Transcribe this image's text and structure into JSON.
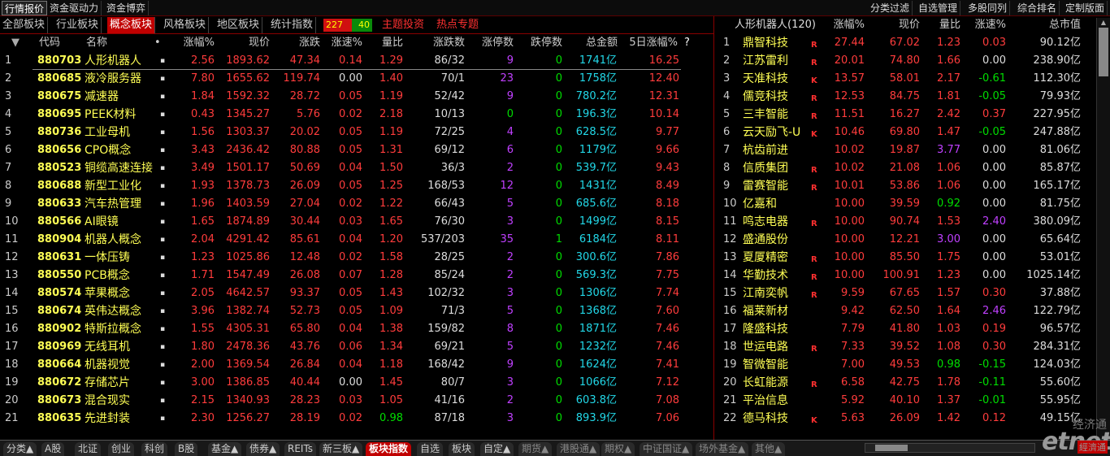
{
  "top_tabs": [
    "行情报价",
    "资金驱动力",
    "资金博弈"
  ],
  "top_right_tabs": [
    "分类过滤",
    "自选管理",
    "多股同列",
    "综合排名",
    "定制版面"
  ],
  "sector_tabs": [
    "全部板块",
    "行业板块",
    "概念板块",
    "风格板块",
    "地区板块",
    "统计指数"
  ],
  "active_sector_tab": "概念板块",
  "ratio": {
    "up": "227",
    "down": "40"
  },
  "links": [
    "主题投资",
    "热点专题"
  ],
  "columns": {
    "sort": "▼",
    "code": "代码",
    "name": "名称",
    "dot": "•",
    "pct": "涨幅%",
    "price": "现价",
    "change": "涨跌",
    "speed": "涨速%",
    "vol_ratio": "量比",
    "updown": "涨跌数",
    "limit_up": "涨停数",
    "limit_down": "跌停数",
    "amount": "总金额",
    "pct5": "5日涨幅%",
    "help": "?"
  },
  "rows": [
    {
      "i": "1",
      "code": "880703",
      "name": "人形机器人",
      "pct": "2.56",
      "price": "1893.62",
      "chg": "47.34",
      "speed": "0.14",
      "vr": "1.29",
      "ud": "86/32",
      "lu": "9",
      "ld": "0",
      "amt": "1741",
      "unit": "亿",
      "p5": "16.25"
    },
    {
      "i": "2",
      "code": "880685",
      "name": "液冷服务器",
      "pct": "7.80",
      "price": "1655.62",
      "chg": "119.74",
      "speed": "0.00",
      "vr": "1.40",
      "ud": "70/1",
      "lu": "23",
      "ld": "0",
      "amt": "1758",
      "unit": "亿",
      "p5": "12.40"
    },
    {
      "i": "3",
      "code": "880675",
      "name": "减速器",
      "pct": "1.84",
      "price": "1592.32",
      "chg": "28.72",
      "speed": "0.05",
      "vr": "1.19",
      "ud": "52/42",
      "lu": "9",
      "ld": "0",
      "amt": "780.2",
      "unit": "亿",
      "p5": "12.31"
    },
    {
      "i": "4",
      "code": "880695",
      "name": "PEEK材料",
      "pct": "0.43",
      "price": "1345.27",
      "chg": "5.76",
      "speed": "0.02",
      "vr": "2.18",
      "ud": "10/13",
      "lu": "0",
      "ld": "0",
      "amt": "196.3",
      "unit": "亿",
      "p5": "10.14"
    },
    {
      "i": "5",
      "code": "880736",
      "name": "工业母机",
      "pct": "1.56",
      "price": "1303.37",
      "chg": "20.02",
      "speed": "0.05",
      "vr": "1.19",
      "ud": "72/25",
      "lu": "4",
      "ld": "0",
      "amt": "628.5",
      "unit": "亿",
      "p5": "9.77"
    },
    {
      "i": "6",
      "code": "880656",
      "name": "CPO概念",
      "pct": "3.43",
      "price": "2436.42",
      "chg": "80.88",
      "speed": "0.05",
      "vr": "1.31",
      "ud": "69/12",
      "lu": "6",
      "ld": "0",
      "amt": "1179",
      "unit": "亿",
      "p5": "9.66"
    },
    {
      "i": "7",
      "code": "880523",
      "name": "铜缆高速连接",
      "pct": "3.49",
      "price": "1501.17",
      "chg": "50.69",
      "speed": "0.04",
      "vr": "1.50",
      "ud": "36/3",
      "lu": "2",
      "ld": "0",
      "amt": "539.7",
      "unit": "亿",
      "p5": "9.43"
    },
    {
      "i": "8",
      "code": "880688",
      "name": "新型工业化",
      "pct": "1.93",
      "price": "1378.73",
      "chg": "26.09",
      "speed": "0.05",
      "vr": "1.25",
      "ud": "168/53",
      "lu": "12",
      "ld": "0",
      "amt": "1431",
      "unit": "亿",
      "p5": "8.49"
    },
    {
      "i": "9",
      "code": "880633",
      "name": "汽车热管理",
      "pct": "1.96",
      "price": "1403.59",
      "chg": "27.04",
      "speed": "0.02",
      "vr": "1.22",
      "ud": "66/43",
      "lu": "5",
      "ld": "0",
      "amt": "685.6",
      "unit": "亿",
      "p5": "8.18"
    },
    {
      "i": "10",
      "code": "880566",
      "name": "AI眼镜",
      "pct": "1.65",
      "price": "1874.89",
      "chg": "30.44",
      "speed": "0.03",
      "vr": "1.65",
      "ud": "76/30",
      "lu": "3",
      "ld": "0",
      "amt": "1499",
      "unit": "亿",
      "p5": "8.15"
    },
    {
      "i": "11",
      "code": "880904",
      "name": "机器人概念",
      "pct": "2.04",
      "price": "4291.42",
      "chg": "85.61",
      "speed": "0.04",
      "vr": "1.20",
      "ud": "537/203",
      "lu": "35",
      "ld": "1",
      "amt": "6184",
      "unit": "亿",
      "p5": "8.11"
    },
    {
      "i": "12",
      "code": "880631",
      "name": "一体压铸",
      "pct": "1.23",
      "price": "1025.86",
      "chg": "12.48",
      "speed": "0.02",
      "vr": "1.58",
      "ud": "28/25",
      "lu": "2",
      "ld": "0",
      "amt": "300.6",
      "unit": "亿",
      "p5": "7.86"
    },
    {
      "i": "13",
      "code": "880550",
      "name": "PCB概念",
      "pct": "1.71",
      "price": "1547.49",
      "chg": "26.08",
      "speed": "0.07",
      "vr": "1.28",
      "ud": "85/24",
      "lu": "2",
      "ld": "0",
      "amt": "569.3",
      "unit": "亿",
      "p5": "7.75"
    },
    {
      "i": "14",
      "code": "880574",
      "name": "苹果概念",
      "pct": "2.05",
      "price": "4642.57",
      "chg": "93.37",
      "speed": "0.05",
      "vr": "1.43",
      "ud": "102/32",
      "lu": "3",
      "ld": "0",
      "amt": "1306",
      "unit": "亿",
      "p5": "7.74"
    },
    {
      "i": "15",
      "code": "880674",
      "name": "英伟达概念",
      "pct": "3.96",
      "price": "1382.74",
      "chg": "52.73",
      "speed": "0.05",
      "vr": "1.09",
      "ud": "71/3",
      "lu": "5",
      "ld": "0",
      "amt": "1368",
      "unit": "亿",
      "p5": "7.60"
    },
    {
      "i": "16",
      "code": "880902",
      "name": "特斯拉概念",
      "pct": "1.55",
      "price": "4305.31",
      "chg": "65.80",
      "speed": "0.04",
      "vr": "1.38",
      "ud": "159/82",
      "lu": "8",
      "ld": "0",
      "amt": "1871",
      "unit": "亿",
      "p5": "7.46"
    },
    {
      "i": "17",
      "code": "880969",
      "name": "无线耳机",
      "pct": "1.80",
      "price": "2478.36",
      "chg": "43.76",
      "speed": "0.06",
      "vr": "1.34",
      "ud": "69/21",
      "lu": "5",
      "ld": "0",
      "amt": "1232",
      "unit": "亿",
      "p5": "7.46"
    },
    {
      "i": "18",
      "code": "880664",
      "name": "机器视觉",
      "pct": "2.00",
      "price": "1369.54",
      "chg": "26.84",
      "speed": "0.04",
      "vr": "1.18",
      "ud": "168/42",
      "lu": "9",
      "ld": "0",
      "amt": "1624",
      "unit": "亿",
      "p5": "7.41"
    },
    {
      "i": "19",
      "code": "880672",
      "name": "存储芯片",
      "pct": "3.00",
      "price": "1386.85",
      "chg": "40.44",
      "speed": "0.00",
      "vr": "1.45",
      "ud": "80/7",
      "lu": "3",
      "ld": "0",
      "amt": "1066",
      "unit": "亿",
      "p5": "7.12"
    },
    {
      "i": "20",
      "code": "880673",
      "name": "混合现实",
      "pct": "2.15",
      "price": "1340.93",
      "chg": "28.23",
      "speed": "0.03",
      "vr": "1.05",
      "ud": "41/16",
      "lu": "2",
      "ld": "0",
      "amt": "603.8",
      "unit": "亿",
      "p5": "7.08"
    },
    {
      "i": "21",
      "code": "880635",
      "name": "先进封装",
      "pct": "2.30",
      "price": "1256.27",
      "chg": "28.19",
      "speed": "0.02",
      "vr": "0.98",
      "ud": "87/18",
      "lu": "3",
      "ld": "0",
      "amt": "893.9",
      "unit": "亿",
      "p5": "7.06"
    }
  ],
  "right_panel": {
    "title": "人形机器人(120)",
    "columns": {
      "pct": "涨幅%",
      "price": "现价",
      "vr": "量比",
      "speed": "涨速%",
      "cap": "总市值"
    },
    "rows": [
      {
        "i": "1",
        "name": "鼎智科技",
        "badge": "R",
        "pct": "27.44",
        "price": "67.02",
        "vr": "1.23",
        "speed": "0.03",
        "cap": "90.12亿"
      },
      {
        "i": "2",
        "name": "江苏雷利",
        "badge": "R",
        "pct": "20.01",
        "price": "74.80",
        "vr": "1.66",
        "speed": "0.00",
        "cap": "238.90亿"
      },
      {
        "i": "3",
        "name": "天准科技",
        "badge": "K",
        "pct": "13.57",
        "price": "58.01",
        "vr": "2.17",
        "speed": "-0.61",
        "cap": "112.30亿"
      },
      {
        "i": "4",
        "name": "儒竞科技",
        "badge": "R",
        "pct": "12.53",
        "price": "84.75",
        "vr": "1.81",
        "speed": "-0.05",
        "cap": "79.93亿"
      },
      {
        "i": "5",
        "name": "三丰智能",
        "badge": "R",
        "pct": "11.51",
        "price": "16.27",
        "vr": "2.42",
        "speed": "0.37",
        "cap": "227.95亿"
      },
      {
        "i": "6",
        "name": "云天励飞-U",
        "badge": "K",
        "pct": "10.46",
        "price": "69.80",
        "vr": "1.47",
        "speed": "-0.05",
        "cap": "247.88亿"
      },
      {
        "i": "7",
        "name": "杭齿前进",
        "badge": "",
        "pct": "10.02",
        "price": "19.87",
        "vr": "3.77",
        "speed": "0.00",
        "cap": "81.06亿"
      },
      {
        "i": "8",
        "name": "信质集团",
        "badge": "R",
        "pct": "10.02",
        "price": "21.08",
        "vr": "1.06",
        "speed": "0.00",
        "cap": "85.87亿"
      },
      {
        "i": "9",
        "name": "雷赛智能",
        "badge": "R",
        "pct": "10.01",
        "price": "53.86",
        "vr": "1.06",
        "speed": "0.00",
        "cap": "165.17亿"
      },
      {
        "i": "10",
        "name": "亿嘉和",
        "badge": "",
        "pct": "10.00",
        "price": "39.59",
        "vr": "0.92",
        "speed": "0.00",
        "cap": "81.75亿"
      },
      {
        "i": "11",
        "name": "鸣志电器",
        "badge": "R",
        "pct": "10.00",
        "price": "90.74",
        "vr": "1.53",
        "speed": "2.40",
        "cap": "380.09亿"
      },
      {
        "i": "12",
        "name": "盛通股份",
        "badge": "",
        "pct": "10.00",
        "price": "12.21",
        "vr": "3.00",
        "speed": "0.00",
        "cap": "65.64亿"
      },
      {
        "i": "13",
        "name": "夏厦精密",
        "badge": "R",
        "pct": "10.00",
        "price": "85.50",
        "vr": "1.75",
        "speed": "0.00",
        "cap": "53.01亿"
      },
      {
        "i": "14",
        "name": "华勤技术",
        "badge": "R",
        "pct": "10.00",
        "price": "100.91",
        "vr": "1.23",
        "speed": "0.00",
        "cap": "1025.14亿"
      },
      {
        "i": "15",
        "name": "江南奕帆",
        "badge": "R",
        "pct": "9.59",
        "price": "67.65",
        "vr": "1.57",
        "speed": "0.30",
        "cap": "37.88亿"
      },
      {
        "i": "16",
        "name": "福莱新材",
        "badge": "",
        "pct": "9.42",
        "price": "62.50",
        "vr": "1.64",
        "speed": "2.46",
        "cap": "122.79亿"
      },
      {
        "i": "17",
        "name": "隆盛科技",
        "badge": "",
        "pct": "7.79",
        "price": "41.80",
        "vr": "1.03",
        "speed": "0.19",
        "cap": "96.57亿"
      },
      {
        "i": "18",
        "name": "世运电路",
        "badge": "R",
        "pct": "7.33",
        "price": "39.52",
        "vr": "1.08",
        "speed": "0.30",
        "cap": "284.31亿"
      },
      {
        "i": "19",
        "name": "智微智能",
        "badge": "",
        "pct": "7.00",
        "price": "49.53",
        "vr": "0.98",
        "speed": "-0.15",
        "cap": "124.03亿"
      },
      {
        "i": "20",
        "name": "长虹能源",
        "badge": "R",
        "pct": "6.58",
        "price": "42.75",
        "vr": "1.78",
        "speed": "-0.11",
        "cap": "55.60亿"
      },
      {
        "i": "21",
        "name": "平治信息",
        "badge": "",
        "pct": "5.92",
        "price": "40.10",
        "vr": "1.37",
        "speed": "-0.01",
        "cap": "55.95亿"
      },
      {
        "i": "22",
        "name": "德马科技",
        "badge": "K",
        "pct": "5.63",
        "price": "26.09",
        "vr": "1.42",
        "speed": "0.12",
        "cap": "49.15亿"
      }
    ]
  },
  "bottom_tabs": [
    "分类▲",
    "A股",
    "北证",
    "创业",
    "科创",
    "B股",
    "基金▲",
    "债券▲",
    "REITs",
    "新三板▲",
    "板块指数",
    "自选",
    "板块",
    "自定▲",
    "期货▲",
    "港股通▲",
    "期权▲",
    "中证国证▲",
    "场外基金▲",
    "其他▲"
  ],
  "active_bottom_tab": "板块指数",
  "watermark": {
    "top": "经济通",
    "logo": "etnet",
    "badge": "經濟通"
  },
  "colors": {
    "up": "#ff3c3c",
    "down": "#00dd00",
    "active_tab": "#c00000",
    "code": "#ffff55",
    "amount": "#22d8e8",
    "limit_up": "#c040ff"
  }
}
